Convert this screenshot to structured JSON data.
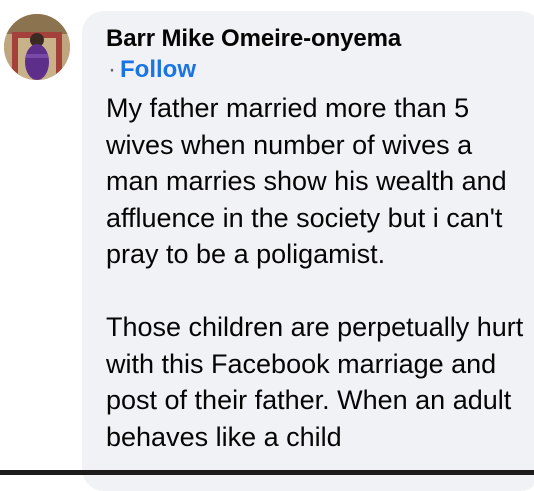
{
  "comment": {
    "author": "Barr Mike Omeire-onyema",
    "separator": "·",
    "follow_label": "Follow",
    "paragraphs": [
      "My father married more than 5 wives when number of wives a man marries show his wealth and affluence in the society but i can't pray to be a poligamist.",
      "Those children are perpetually hurt with this Facebook marriage and post of their father. When an adult behaves like a child"
    ]
  },
  "colors": {
    "bubble": "#f0f2f5",
    "follow_link": "#1b74e4",
    "text": "#050505"
  },
  "icons": {
    "avatar": "profile-photo"
  }
}
